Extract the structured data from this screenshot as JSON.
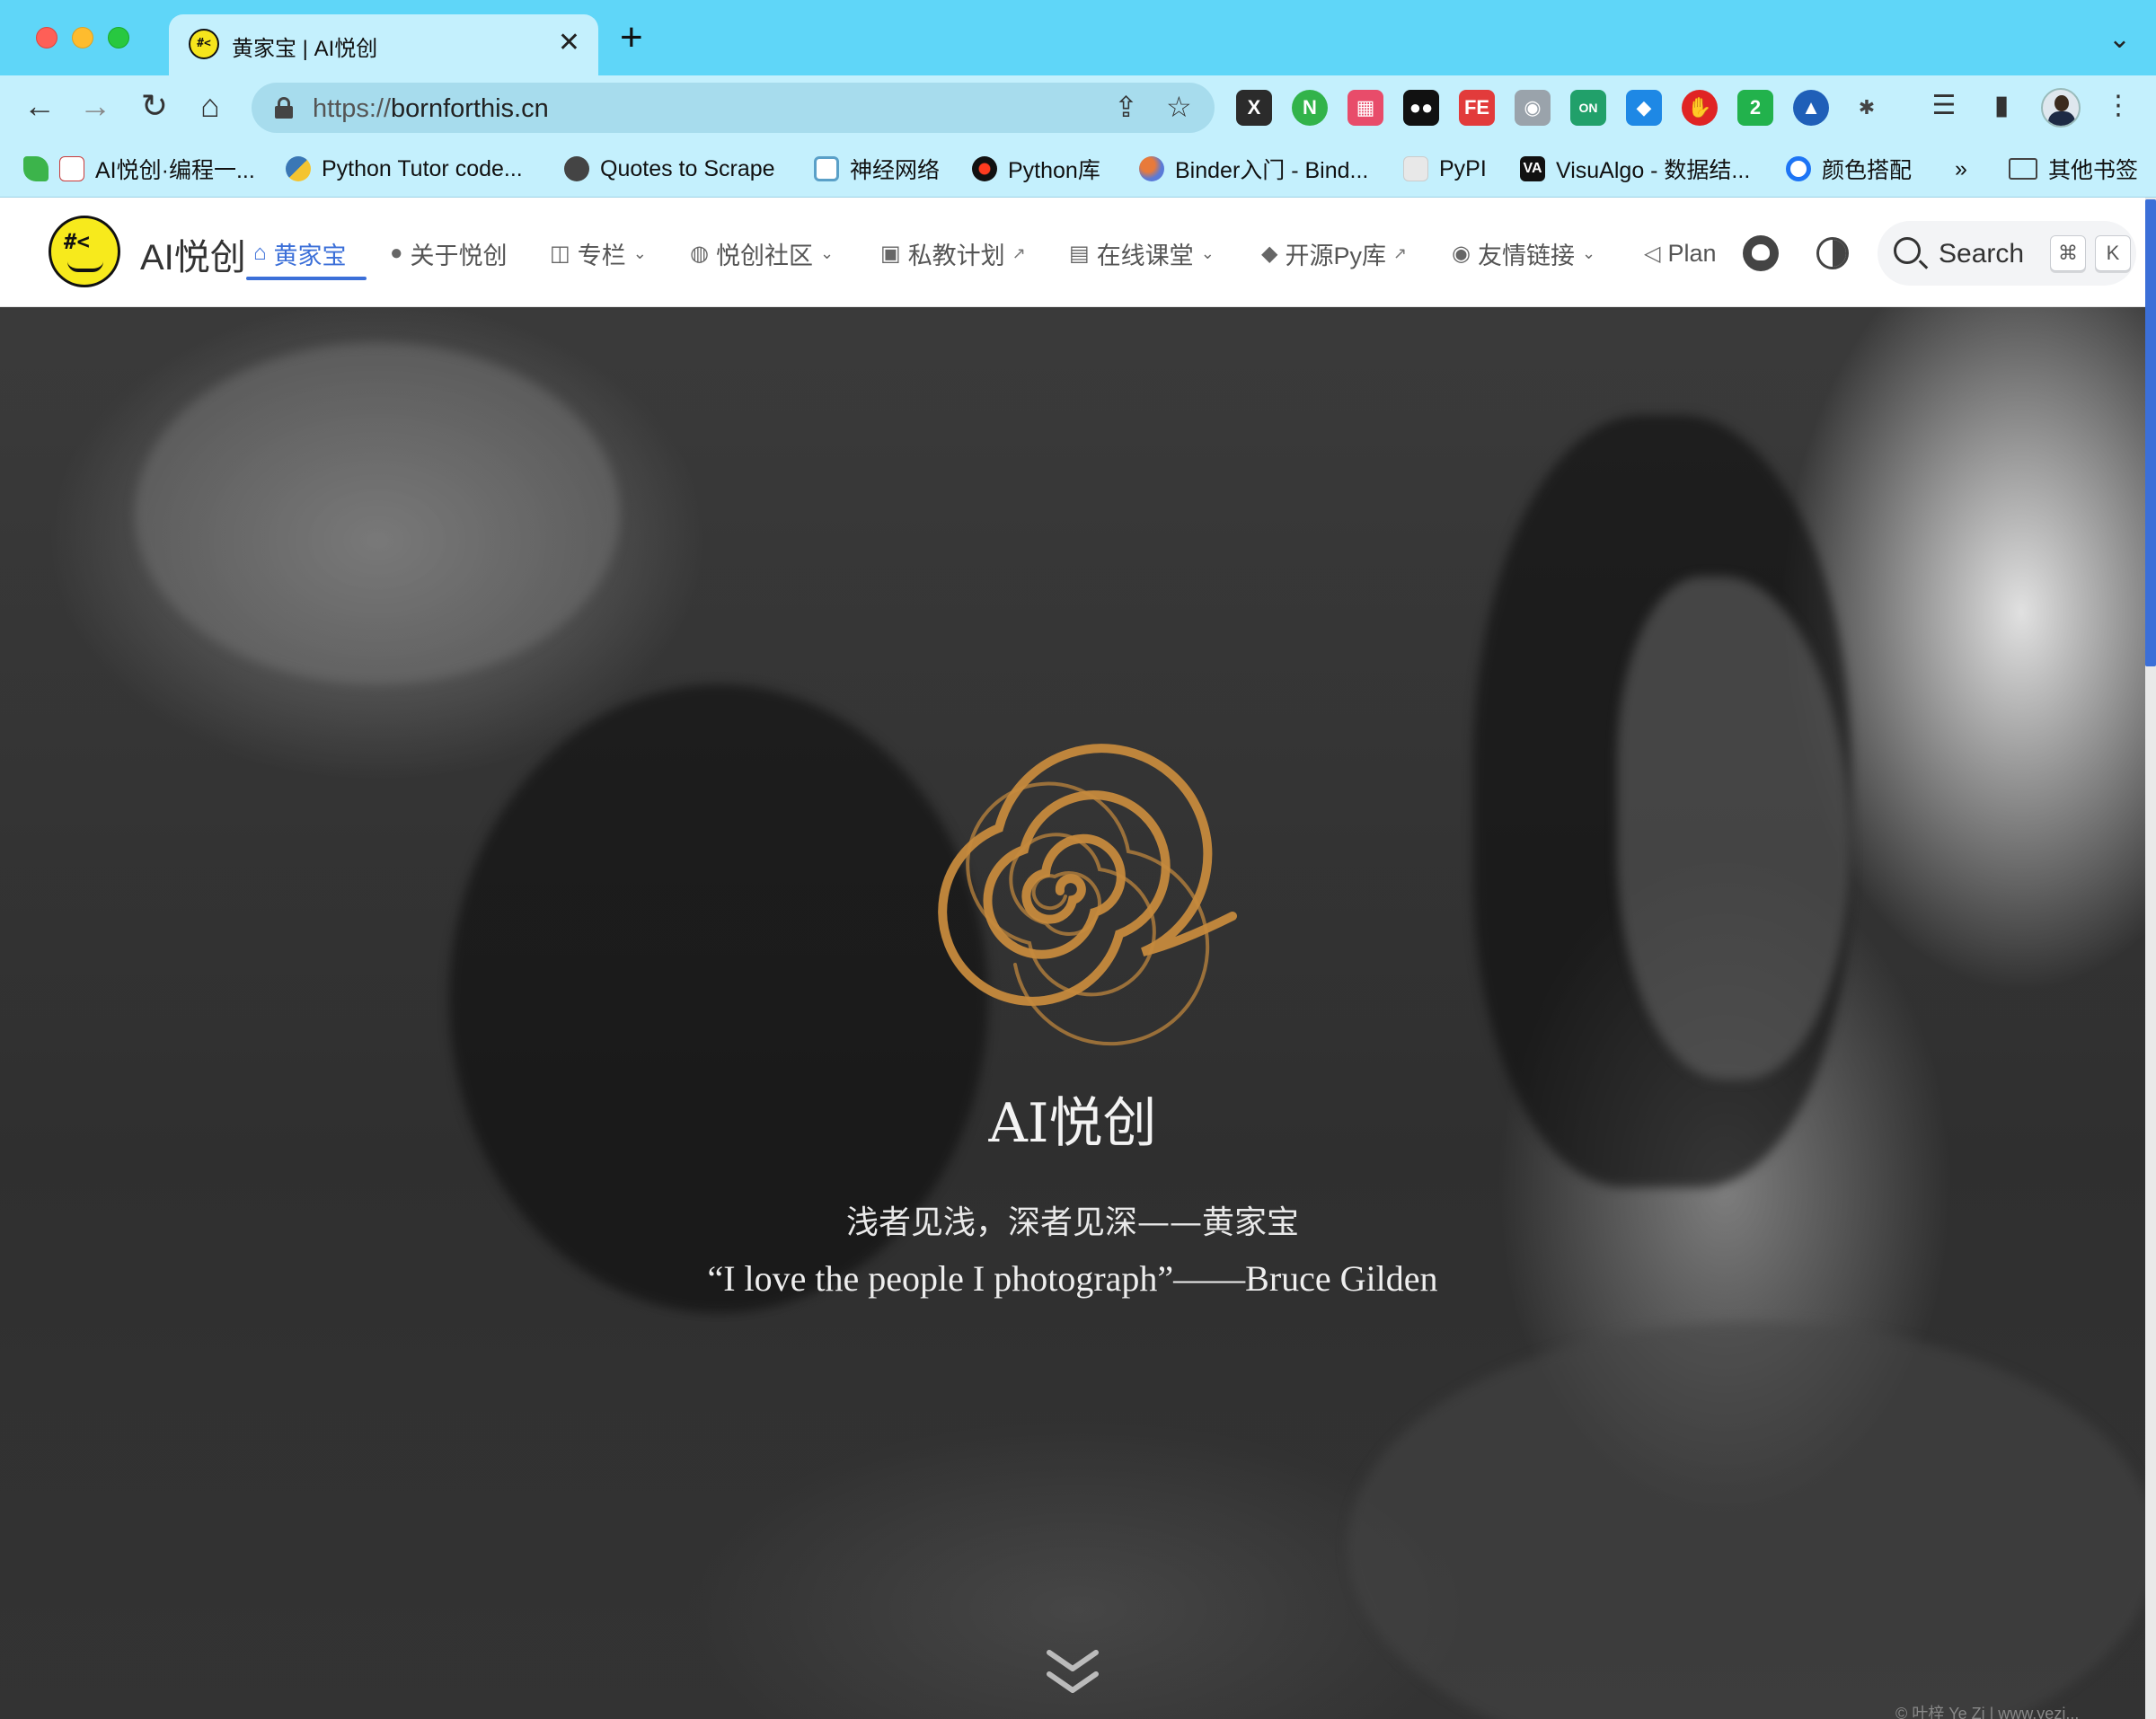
{
  "browser": {
    "tab_title": "黄家宝 | AI悦创",
    "tab_favicon_text": "#<",
    "new_tab_label": "+",
    "close_tab_label": "✕",
    "url_scheme": "https://",
    "url_host": "bornforthis.cn",
    "nav": {
      "back": "←",
      "forward": "→",
      "reload": "↻",
      "home": "⌂"
    },
    "extensions": [
      {
        "name": "x-extension",
        "label": "X",
        "color": "#2b2b2b"
      },
      {
        "name": "n-extension",
        "label": "N",
        "color": "#32b34a"
      },
      {
        "name": "grid-extension",
        "label": "▦",
        "color": "#e84c6a"
      },
      {
        "name": "eyes-extension",
        "label": "●●",
        "color": "#111111"
      },
      {
        "name": "fe-extension",
        "label": "FE",
        "color": "#e23b3b"
      },
      {
        "name": "camera-extension",
        "label": "◉",
        "color": "#9aa3ab"
      },
      {
        "name": "on-extension",
        "label": "ON",
        "color": "#21a06a"
      },
      {
        "name": "cat-extension",
        "label": "◆",
        "color": "#1e88e5"
      },
      {
        "name": "stop-extension",
        "label": "✋",
        "color": "#e02424"
      },
      {
        "name": "shield-extension",
        "label": "2",
        "color": "#22b24c"
      },
      {
        "name": "triangle-extension",
        "label": "▲",
        "color": "#1f5fb8"
      },
      {
        "name": "puzzle-extension",
        "label": "✱",
        "color": "#4a4a4a"
      }
    ],
    "bookmarks": [
      {
        "label": "AI悦创·编程一...",
        "color": "#c83a3a"
      },
      {
        "label": "Python Tutor code...",
        "color": "#3a77b5"
      },
      {
        "label": "Quotes to Scrape",
        "color": "#444444"
      },
      {
        "label": "神经网络",
        "color": "#5aa0c8"
      },
      {
        "label": "Python库",
        "color": "#cc2222"
      },
      {
        "label": "Binder入门 - Bind...",
        "color": "#e87a3a"
      },
      {
        "label": "PyPI",
        "color": "#e5e5e5"
      },
      {
        "label": "VisuAlgo - 数据结...",
        "color": "#111111"
      },
      {
        "label": "颜色搭配",
        "color": "#1d74f5"
      }
    ],
    "bookmarks_more": "»",
    "other_bookmarks": "其他书签"
  },
  "site": {
    "brand": "AI悦创",
    "nav": [
      {
        "icon": "⌂",
        "label": "黄家宝",
        "active": true
      },
      {
        "icon": "●",
        "label": "关于悦创"
      },
      {
        "icon": "◫",
        "label": "专栏",
        "dropdown": true
      },
      {
        "icon": "◍",
        "label": "悦创社区",
        "dropdown": true
      },
      {
        "icon": "▣",
        "label": "私教计划",
        "external": true
      },
      {
        "icon": "▤",
        "label": "在线课堂",
        "dropdown": true
      },
      {
        "icon": "◆",
        "label": "开源Py库",
        "external": true
      },
      {
        "icon": "◉",
        "label": "友情链接",
        "dropdown": true
      },
      {
        "icon": "◁",
        "label": "Plan"
      }
    ],
    "caret": "⌄",
    "external_mark": "↗",
    "search_label": "Search",
    "search_keys": [
      "⌘",
      "K"
    ]
  },
  "hero": {
    "title": "AI悦创",
    "line1": "浅者见浅，深者见深——黄家宝",
    "line2": "“I love the people I photograph”——Bruce Gilden",
    "credit": "© 叶梓 Ye Zi | www.yezi..."
  },
  "colors": {
    "accent": "#3b6fd8",
    "spiral": "#c68a3d",
    "chrome": "#5fd6f8"
  }
}
